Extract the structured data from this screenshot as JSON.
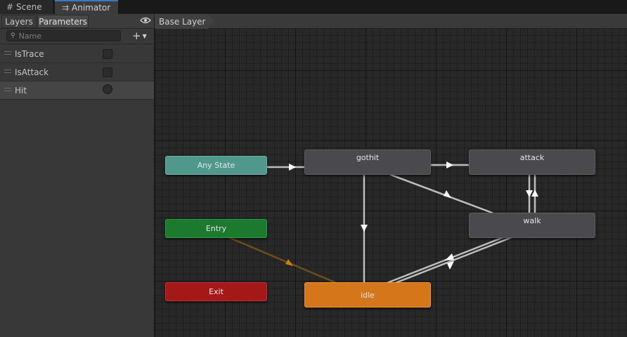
{
  "tabs": [
    {
      "label": "Scene",
      "icon": "grid-icon"
    },
    {
      "label": "Animator",
      "icon": "animator-icon"
    }
  ],
  "left_panel": {
    "tabs": {
      "layers": "Layers",
      "parameters": "Parameters"
    },
    "search": {
      "placeholder": "Name",
      "value": ""
    },
    "add_label": "+",
    "parameters": [
      {
        "name": "IsTrace",
        "type": "bool",
        "value": false
      },
      {
        "name": "IsAttack",
        "type": "bool",
        "value": false
      },
      {
        "name": "Hit",
        "type": "trigger",
        "value": false
      }
    ]
  },
  "breadcrumb": "Base Layer",
  "states": {
    "any_state": "Any State",
    "entry": "Entry",
    "exit": "Exit",
    "gothit": "gothit",
    "attack": "attack",
    "walk": "walk",
    "idle": "idle"
  },
  "colors": {
    "any_state": "#51988c",
    "entry": "#1c7a2e",
    "exit": "#a41818",
    "default_state": "#d5761b",
    "state": "#4a4a4e",
    "tab_highlight": "#3a79bb"
  }
}
